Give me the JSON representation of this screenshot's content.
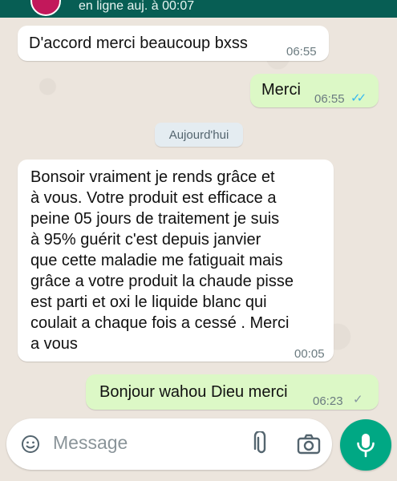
{
  "header": {
    "status": "en ligne auj. à 00:07"
  },
  "messages": [
    {
      "dir": "in",
      "text": "D'accord merci beaucoup bxss",
      "time": "06:55"
    },
    {
      "dir": "out",
      "text": "Merci",
      "time": "06:55",
      "ticks": "✓✓",
      "read": true
    },
    {
      "dir": "in",
      "text": "Bonsoir vraiment je rends grâce et\nà vous. Votre produit est efficace a\npeine 05 jours de traitement je suis\nà 95% guérit c'est depuis janvier\nque cette maladie me fatiguait mais\ngrâce a votre produit la chaude pisse\nest parti et oxi le liquide blanc qui\ncoulait a chaque fois a cessé . Merci\na vous",
      "time": "00:05"
    },
    {
      "dir": "out",
      "text": "Bonjour wahou Dieu merci",
      "time": "06:23",
      "ticks": "✓",
      "read": false
    }
  ],
  "day_separator": "Aujourd'hui",
  "composer": {
    "placeholder": "Message"
  },
  "colors": {
    "outgoing_bubble": "#dcf8c6",
    "incoming_bubble": "#ffffff",
    "read_ticks": "#34b7f1",
    "sent_tick": "#8696a0",
    "accent": "#00a884"
  },
  "icons": [
    "emoji-icon",
    "attach-icon",
    "camera-icon",
    "mic-icon"
  ]
}
